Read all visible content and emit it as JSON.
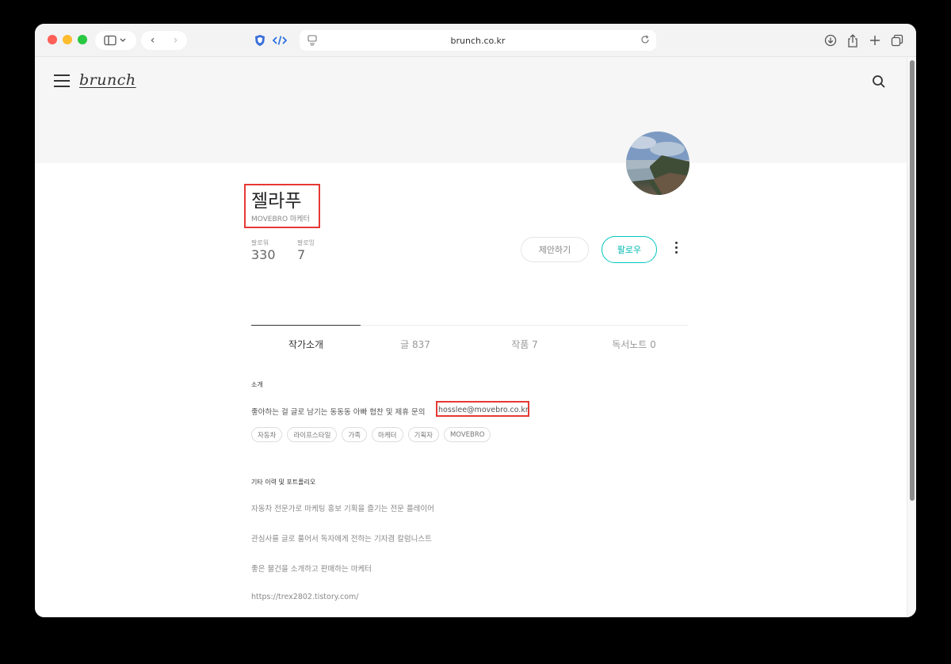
{
  "browser": {
    "url": "brunch.co.kr",
    "nav": {
      "back": "‹",
      "forward": "›"
    }
  },
  "site": {
    "logo": "brunch"
  },
  "profile": {
    "name": "젤라푸",
    "subtitle": "MOVEBRO 마케터",
    "followers_label": "팔로워",
    "followers_count": "330",
    "following_label": "팔로잉",
    "following_count": "7",
    "propose_label": "제안하기",
    "follow_label": "팔로우"
  },
  "tabs": [
    {
      "label": "작가소개"
    },
    {
      "label": "글 837"
    },
    {
      "label": "작품 7"
    },
    {
      "label": "독서노트 0"
    }
  ],
  "intro": {
    "title": "소개",
    "text": "좋아하는 걸 글로 남기는 동동동 아빠 협찬 및 제휴 문의",
    "email": "hosslee@movebro.co.kr",
    "tags": [
      "자동차",
      "라이프스타일",
      "가족",
      "마케터",
      "기획자",
      "MOVEBRO"
    ]
  },
  "career": {
    "title": "기타 이력 및 포트폴리오",
    "items": [
      "자동차 전문가로 마케팅 홍보 기획을 즐기는 전문 플레이어",
      "관심사를 글로 풀어서 독자에게 전하는 기자겸 칼럼니스트",
      "좋은 물건을 소개하고 판매하는 마케터",
      "https://trex2802.tistory.com/"
    ]
  }
}
